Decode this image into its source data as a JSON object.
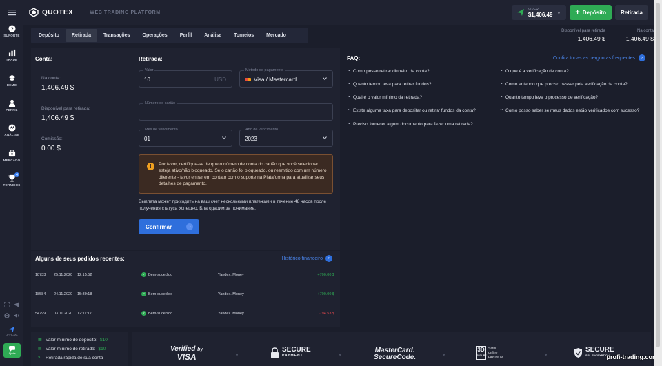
{
  "app": {
    "name": "QUOTEX",
    "subtitle": "WEB TRADING PLATFORM"
  },
  "account": {
    "level": "VIVER",
    "balance": "$1,406.49",
    "deposit_label": "Depósito",
    "withdraw_label": "Retirada"
  },
  "sidebar": {
    "items": [
      {
        "label": "SUPORTE",
        "icon": "help-circle-icon"
      },
      {
        "label": "TRADE",
        "icon": "bar-chart-icon"
      },
      {
        "label": "DEMO",
        "icon": "graduation-cap-icon"
      },
      {
        "label": "PERFIL",
        "icon": "user-icon"
      },
      {
        "label": "ANÁLISE",
        "icon": "analytics-icon"
      },
      {
        "label": "MERCADO",
        "icon": "market-icon"
      },
      {
        "label": "TORNEIOS",
        "icon": "trophy-icon",
        "badge": "4"
      }
    ],
    "official_label": "OFFICIAL",
    "help_label": "Ajuda"
  },
  "tabs": [
    "Depósito",
    "Retirada",
    "Transações",
    "Operações",
    "Perfil",
    "Análise",
    "Torneios",
    "Mercado"
  ],
  "active_tab": "Retirada",
  "balances": {
    "available_label": "Disponível para retirada",
    "available_value": "1,406.49 $",
    "account_label": "Na conta",
    "account_value": "1,406.49 $"
  },
  "account_panel": {
    "title": "Conta:",
    "in_account_label": "Na conta:",
    "in_account_value": "1,406.49 $",
    "available_label": "Disponível para retirada:",
    "available_value": "1,406.49 $",
    "commission_label": "Comissão:",
    "commission_value": "0.00 $"
  },
  "withdraw": {
    "title": "Retirada:",
    "amount_label": "Valor",
    "amount_value": "10",
    "amount_suffix": "USD",
    "method_label": "Método de pagamento",
    "method_value": "Visa / Mastercard",
    "card_label": "Número do cartão",
    "month_label": "Mês de vencimento",
    "month_value": "01",
    "year_label": "Ano de vencimento",
    "year_value": "2023",
    "warning": "Por favor, certifique-se de que o número de conta do cartão que você selecionar esteja ativo/não bloqueado. Se o cartão foi bloqueado, ou reemitido com um número diferente - favor entrar em contato com o suporte na Plataforma para atualizar seus detalhes de pagamento.",
    "note": "Выплата может приходить на ваш счет несколькими платежами в течение 48 часов после получения статуса Успешно. Благодарим за понимание.",
    "confirm_label": "Confirmar"
  },
  "recent": {
    "title": "Alguns de seus pedidos recentes:",
    "history_link": "Histórico financeiro",
    "rows": [
      {
        "id": "18733",
        "date": "25.11.2020",
        "time": "12:15:52",
        "status": "Bem-sucedido",
        "method": "Yandex. Money",
        "amount": "+700.00 $"
      },
      {
        "id": "18584",
        "date": "24.11.2020",
        "time": "15:39:18",
        "status": "Bem-sucedido",
        "method": "Yandex. Money",
        "amount": "+700.00 $"
      },
      {
        "id": "54799",
        "date": "03.11.2020",
        "time": "12:11:17",
        "status": "Bem-sucedido",
        "method": "Yandex. Money",
        "amount": "-794.53 $"
      }
    ]
  },
  "faq": {
    "title": "FAQ:",
    "all_link": "Confira todas as perguntas frequentes",
    "left": [
      "Como posso retirar dinheiro da conta?",
      "Quanto tempo leva para retirar fundos?",
      "Qual é o valor mínimo da retirada?",
      "Existe alguma taxa para depositar ou retirar fundos da conta?",
      "Preciso fornecer algum documento para fazer uma retirada?"
    ],
    "right": [
      "O que é a verificação de conta?",
      "Como entendo que preciso passar pela verificação da conta?",
      "Quanto tempo leva o processo de verificação?",
      "Como posso saber se meus dados estão verificados com sucesso?"
    ]
  },
  "footer": {
    "min_deposit_label": "Valor mínimo do depósito:",
    "min_deposit_value": "$10",
    "min_withdraw_label": "Valor mínimo de retirada:",
    "min_withdraw_value": "$10",
    "fast_withdraw": "Retirada rápida de sua conta",
    "logos": {
      "verified": "Verified",
      "by": "by",
      "visa": "VISA",
      "secure_payment": "SECURE",
      "secure_payment_sub": "PAYMENT",
      "mastercard": "MasterCard.",
      "securecode": "SecureCode.",
      "three_d": "3D",
      "three_d_sub": "SECURE",
      "safer1": "Safer",
      "safer2": "online",
      "safer3": "payments",
      "ssl": "SECURE",
      "ssl_sub": "SSL ENCRYPTION"
    }
  },
  "watermark": "profi-trading.com"
}
